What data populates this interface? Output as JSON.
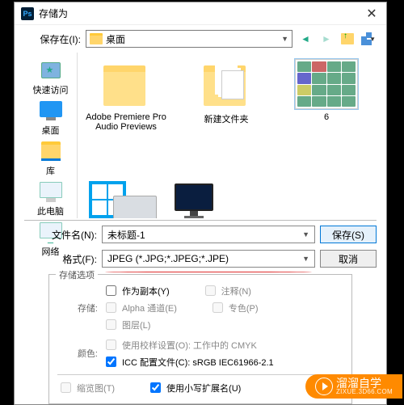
{
  "title": "存储为",
  "savein_label": "保存在(I):",
  "savein_value": "桌面",
  "sidebar": {
    "quick": "快速访问",
    "desktop": "桌面",
    "library": "库",
    "thispc": "此电脑",
    "network": "网络"
  },
  "files": {
    "item1": "Adobe Premiere Pro Audio Previews",
    "item2": "新建文件夹",
    "item3": "6"
  },
  "fields": {
    "filename_label": "文件名(N):",
    "filename_value": "未标题-1",
    "format_label": "格式(F):",
    "format_value": "JPEG (*.JPG;*.JPEG;*.JPE)"
  },
  "buttons": {
    "save": "保存(S)",
    "cancel": "取消"
  },
  "options": {
    "legend": "存储选项",
    "storage_label": "存储:",
    "copy": "作为副本(Y)",
    "notes": "注释(N)",
    "alpha": "Alpha 通道(E)",
    "spot": "专色(P)",
    "layers": "图层(L)",
    "color_label": "颜色:",
    "proof": "使用校样设置(O): 工作中的 CMYK",
    "icc": "ICC 配置文件(C): sRGB IEC61966-2.1",
    "thumb": "缩览图(T)",
    "lowerext": "使用小写扩展名(U)"
  },
  "watermark": {
    "main": "溜溜自学",
    "sub": "ZIXUE.3D66.COM"
  }
}
